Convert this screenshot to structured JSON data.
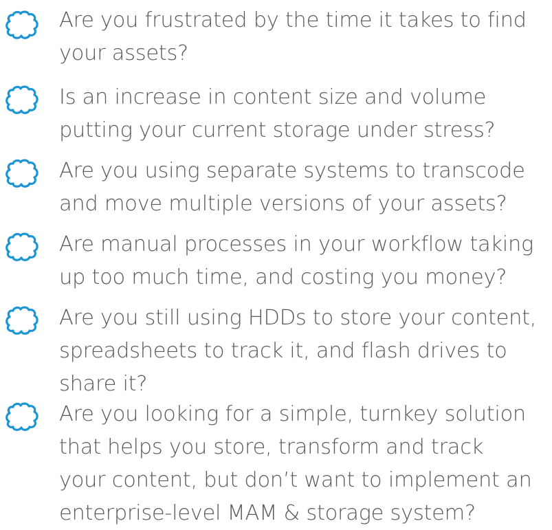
{
  "accent_color": "#1b95d3",
  "text_color": "#5a5a5a",
  "icon": "cloud-outline-icon",
  "items": [
    {
      "lines": [
        "Are you frustrated by the time it takes to find",
        "your assets?"
      ]
    },
    {
      "lines": [
        "Is an increase in content size and volume",
        "putting your current storage under stress?"
      ]
    },
    {
      "lines": [
        "Are you using separate systems to transcode",
        "and move multiple versions of your assets?"
      ]
    },
    {
      "lines": [
        "Are manual processes in your workflow taking",
        "up too much time, and costing you money?"
      ]
    },
    {
      "lines": [
        "Are you still using HDDs to store your content,",
        "spreadsheets to track it, and flash drives to",
        "share it?"
      ]
    },
    {
      "lines": [
        "Are you looking for a simple, turnkey solution",
        "that helps you store, transform and track",
        "your content, but don’t want to implement an",
        "enterprise-level MAM & storage system?"
      ]
    }
  ]
}
